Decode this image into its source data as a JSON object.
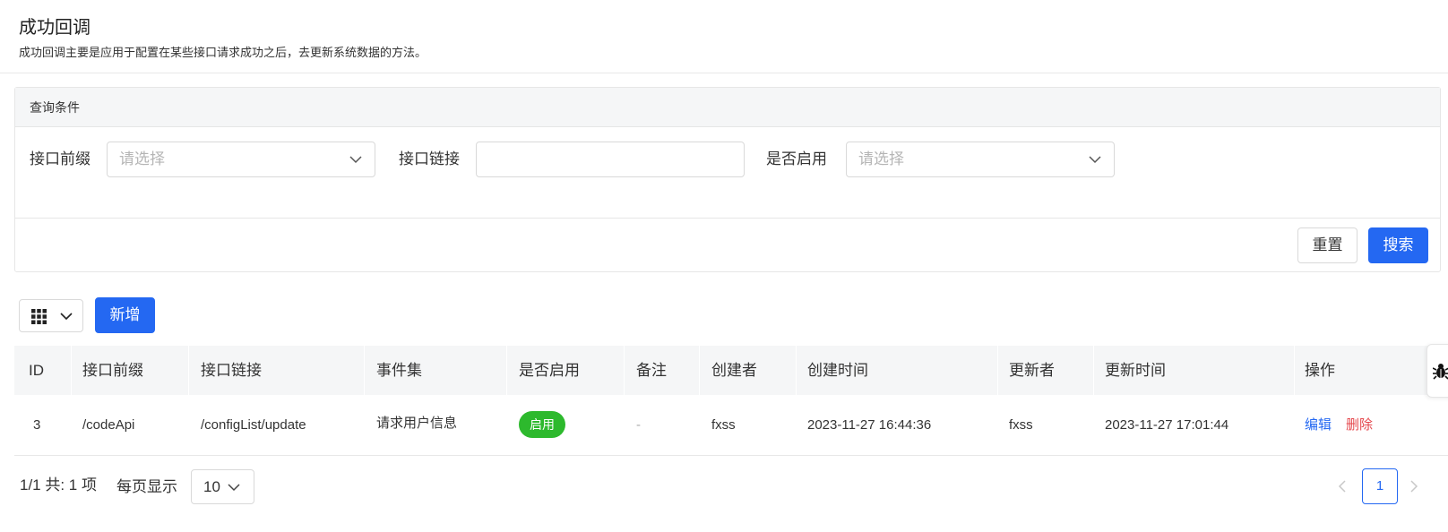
{
  "header": {
    "title": "成功回调",
    "description": "成功回调主要是应用于配置在某些接口请求成功之后，去更新系统数据的方法。"
  },
  "query": {
    "title": "查询条件",
    "fields": {
      "prefix": {
        "label": "接口前缀",
        "placeholder": "请选择"
      },
      "link": {
        "label": "接口链接",
        "value": ""
      },
      "enabled": {
        "label": "是否启用",
        "placeholder": "请选择"
      }
    },
    "reset_label": "重置",
    "search_label": "搜索"
  },
  "toolbar": {
    "grid_icon": "grid-icon",
    "add_label": "新增"
  },
  "table": {
    "columns": [
      "ID",
      "接口前缀",
      "接口链接",
      "事件集",
      "是否启用",
      "备注",
      "创建者",
      "创建时间",
      "更新者",
      "更新时间",
      "操作"
    ],
    "rows": [
      {
        "id": "3",
        "prefix": "/codeApi",
        "link": "/configList/update",
        "events": "请求用户信息",
        "enabled": "启用",
        "remark": "-",
        "creator": "fxss",
        "created_at": "2023-11-27 16:44:36",
        "updater": "fxss",
        "updated_at": "2023-11-27 17:01:44",
        "edit_label": "编辑",
        "delete_label": "删除"
      }
    ]
  },
  "pagination": {
    "summary": "1/1 共: 1 项",
    "per_page_label": "每页显示",
    "page_size": "10",
    "current_page": "1"
  },
  "colors": {
    "primary": "#2468f2",
    "success_badge": "#2db92d",
    "danger": "#e5484d"
  },
  "side_tab": {
    "icon": "bug-icon"
  }
}
